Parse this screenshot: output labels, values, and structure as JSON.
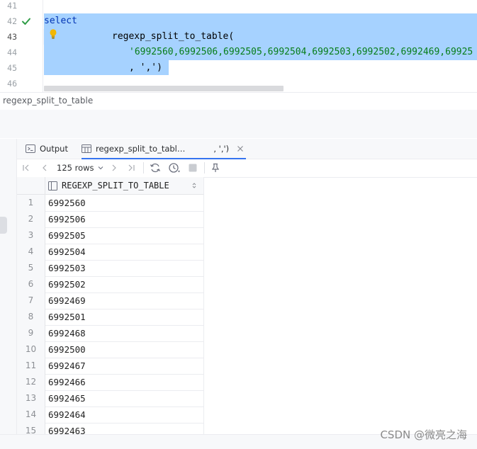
{
  "editor": {
    "line_numbers": [
      "41",
      "42",
      "43",
      "44",
      "45",
      "46"
    ],
    "current_line": "43",
    "code_lines": [
      "select",
      "regexp_split_to_table(",
      "'6992560,6992506,6992505,6992504,6992503,6992502,6992469,69925",
      ", ',')"
    ]
  },
  "breadcrumb": {
    "text": "regexp_split_to_table"
  },
  "tabs": [
    {
      "label": "Output",
      "icon": "console-icon"
    },
    {
      "label": "regexp_split_to_tabl…",
      "suffix": ", ',')",
      "icon": "table-icon"
    }
  ],
  "toolbar": {
    "rows_label": "125 rows"
  },
  "grid": {
    "column": "REGEXP_SPLIT_TO_TABLE",
    "rows": [
      {
        "n": "1",
        "v": "6992560"
      },
      {
        "n": "2",
        "v": "6992506"
      },
      {
        "n": "3",
        "v": "6992505"
      },
      {
        "n": "4",
        "v": "6992504"
      },
      {
        "n": "5",
        "v": "6992503"
      },
      {
        "n": "6",
        "v": "6992502"
      },
      {
        "n": "7",
        "v": "6992469"
      },
      {
        "n": "8",
        "v": "6992501"
      },
      {
        "n": "9",
        "v": "6992468"
      },
      {
        "n": "10",
        "v": "6992500"
      },
      {
        "n": "11",
        "v": "6992467"
      },
      {
        "n": "12",
        "v": "6992466"
      },
      {
        "n": "13",
        "v": "6992465"
      },
      {
        "n": "14",
        "v": "6992464"
      },
      {
        "n": "15",
        "v": "6992463"
      }
    ]
  },
  "watermark": "CSDN @微亮之海",
  "colors": {
    "selection": "#a6d2ff",
    "keyword": "#0033b3",
    "string": "#067d17",
    "accent": "#3574f0"
  }
}
